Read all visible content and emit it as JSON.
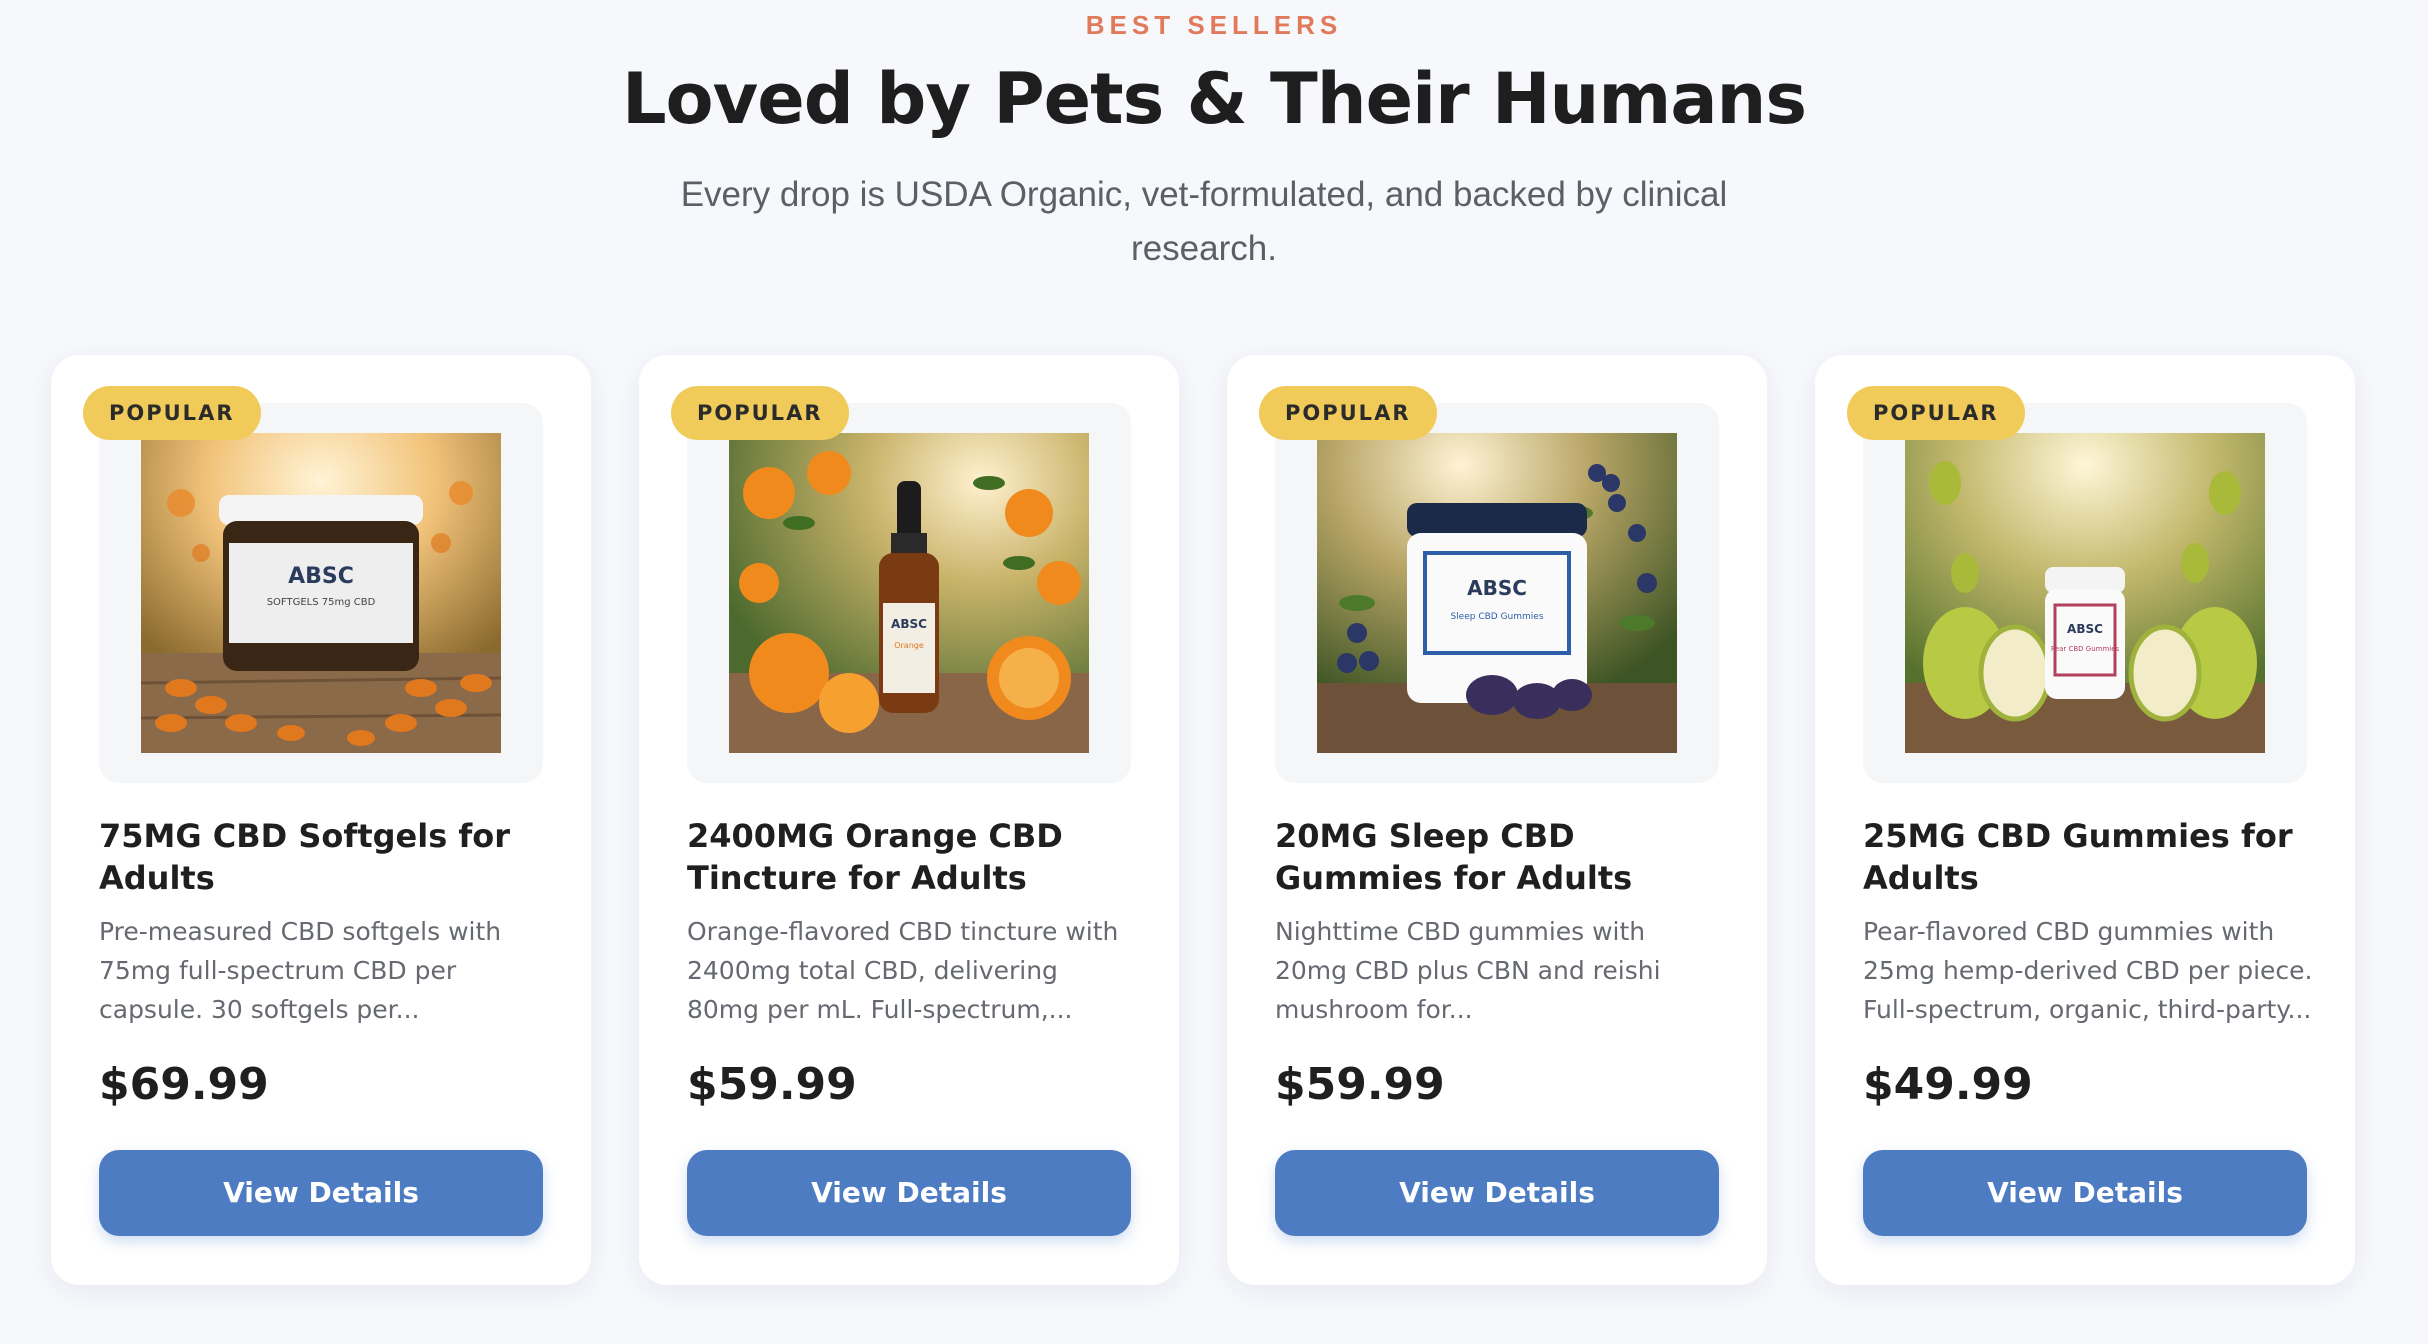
{
  "section": {
    "eyebrow": "BEST SELLERS",
    "heading": "Loved by Pets & Their Humans",
    "subheading": "Every drop is USDA Organic, vet-formulated, and backed by clinical research."
  },
  "colors": {
    "eyebrow": "#e07a5a",
    "badge": "#f1cb5a",
    "button": "#4d7cc3"
  },
  "products": [
    {
      "badge": "POPULAR",
      "image_icon": "softgel-jar-photo",
      "title": "75MG CBD Softgels for Adults",
      "description": "Pre-measured CBD softgels with 75mg full-spectrum CBD per capsule. 30 softgels per...",
      "price": "$69.99",
      "button": "View Details"
    },
    {
      "badge": "POPULAR",
      "image_icon": "orange-tincture-photo",
      "title": "2400MG Orange CBD Tincture for Adults",
      "description": "Orange-flavored CBD tincture with 2400mg total CBD, delivering 80mg per mL. Full-spectrum,...",
      "price": "$59.99",
      "button": "View Details"
    },
    {
      "badge": "POPULAR",
      "image_icon": "sleep-gummies-photo",
      "title": "20MG Sleep CBD Gummies for Adults",
      "description": "Nighttime CBD gummies with 20mg CBD plus CBN and reishi mushroom for...",
      "price": "$59.99",
      "button": "View Details"
    },
    {
      "badge": "POPULAR",
      "image_icon": "pear-gummies-photo",
      "title": "25MG CBD Gummies for Adults",
      "description": "Pear-flavored CBD gummies with 25mg hemp-derived CBD per piece. Full-spectrum, organic, third-party...",
      "price": "$49.99",
      "button": "View Details"
    }
  ]
}
